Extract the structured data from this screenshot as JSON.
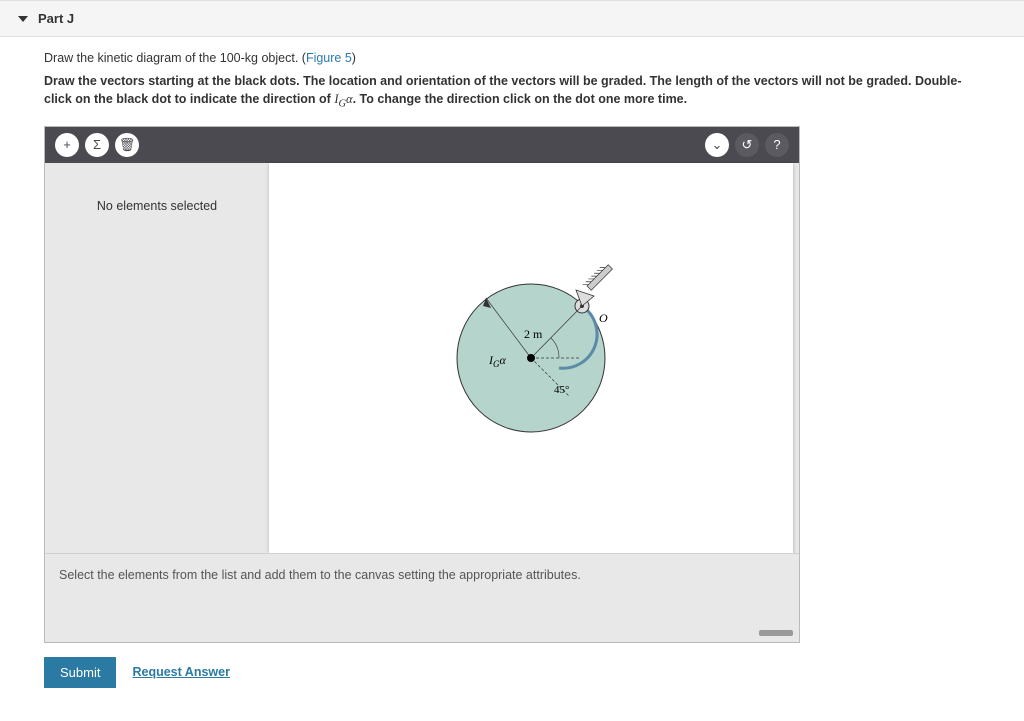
{
  "part": {
    "label": "Part J"
  },
  "intro": {
    "text_before_link": "Draw the kinetic diagram of the 100-kg object. (",
    "link_text": "Figure 5",
    "text_after_link": ")"
  },
  "instructions": {
    "line": "Draw the vectors starting at the black dots. The location and orientation of the vectors will be graded. The length of the vectors will not be graded. Double-click on the black dot to indicate the direction of ",
    "var": "I",
    "var_sub": "G",
    "var_after": "α",
    "line_after": ". To change the direction click on the dot one more time."
  },
  "toolbar": {
    "add": "+",
    "sigma": "Σ",
    "trash": "🗑",
    "dropdown": "⌄",
    "reset": "↺",
    "help": "?"
  },
  "left_pane": {
    "status": "No elements selected"
  },
  "figure": {
    "radius_label": "2 m",
    "i_label": "I",
    "i_sub": "G",
    "alpha": "α",
    "angle_label": "45°",
    "point_label": "O"
  },
  "hint": "Select the elements from the list and add them to the canvas setting the appropriate attributes.",
  "buttons": {
    "submit": "Submit",
    "request_answer": "Request Answer"
  }
}
